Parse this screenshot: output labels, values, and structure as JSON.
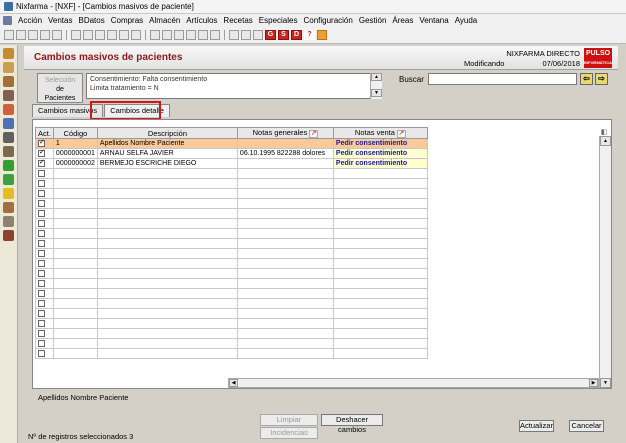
{
  "window": {
    "title": "Nixfarma - [NXF] - [Cambios masivos de paciente]"
  },
  "menu": [
    "Acción",
    "Ventas",
    "BDatos",
    "Compras",
    "Almacén",
    "Artículos",
    "Recetas",
    "Especiales",
    "Configuración",
    "Gestión",
    "Áreas",
    "Ventana",
    "Ayuda"
  ],
  "toolbar": {
    "red_buttons": [
      "G",
      "S",
      "D"
    ],
    "help": "?"
  },
  "header": {
    "title": "Cambios masivos de pacientes",
    "company": "NIXFARMA DIRECTO",
    "status": "Modificando",
    "date": "07/06/2018",
    "logo_line1": "PULSO",
    "logo_line2": "INFORMÁTICA"
  },
  "selection": {
    "button_line1": "Selección",
    "button_line2": "de",
    "button_line3": "Pacientes",
    "criteria_line1": "Consentimiento: Falta consentimiento",
    "criteria_line2": "Limita tratamiento = N"
  },
  "search": {
    "label": "Buscar",
    "value": ""
  },
  "tabs": {
    "masivos": "Cambios masivos",
    "detalle": "Cambios detalle"
  },
  "grid": {
    "headers": {
      "act": "Act.",
      "codigo": "Código",
      "descripcion": "Descripción",
      "notas_generales": "Notas generales",
      "notas_venta": "Notas venta"
    },
    "rows": [
      {
        "act": true,
        "codigo": "1",
        "descripcion": "Apellidos Nombre Paciente",
        "notas_generales": "",
        "notas_venta": "Pedir consentimiento",
        "selected": true
      },
      {
        "act": true,
        "codigo": "0000000001",
        "descripcion": "ARNAU SELFA JAVIER",
        "notas_generales": "06.10.1995 822288   dolores",
        "notas_venta": "Pedir consentimiento",
        "selected": false
      },
      {
        "act": true,
        "codigo": "0000000002",
        "descripcion": "BERMEJO ESCRICHE DIEGO",
        "notas_generales": "",
        "notas_venta": "Pedir consentimiento",
        "selected": false
      }
    ],
    "empty_rows": 19
  },
  "footer": {
    "current_name": "Apellidos Nombre Paciente",
    "count": "Nº de registros seleccionados 3"
  },
  "buttons": {
    "limpiar": "Limpiar",
    "incidencias": "Incidencias",
    "deshacer": "Deshacer cambios",
    "actualizar": "Actualizar",
    "cancelar": "Cancelar"
  },
  "colors": {
    "title_red": "#8b1a1a",
    "highlight": "#d01818",
    "selected_row": "#f9c99a",
    "nota_venta": "#1a1aa0"
  }
}
